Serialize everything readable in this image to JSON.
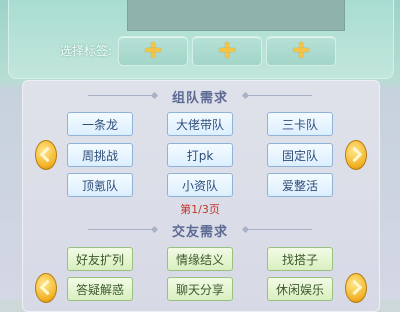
{
  "tag_panel": {
    "label": "选择标签:"
  },
  "team_section": {
    "title": "组队需求",
    "buttons": [
      "一条龙",
      "大佬带队",
      "三卡队",
      "周挑战",
      "打pk",
      "固定队",
      "顶氪队",
      "小资队",
      "爱整活"
    ],
    "page_indicator": "第1/3页"
  },
  "friend_section": {
    "title": "交友需求",
    "buttons": [
      "好友扩列",
      "情缘结义",
      "找搭子",
      "答疑解惑",
      "聊天分享",
      "休闲娱乐"
    ]
  },
  "colors": {
    "accent_gold": "#f2b224",
    "page_red": "#c0392b",
    "title_blue": "#5d6a93"
  }
}
